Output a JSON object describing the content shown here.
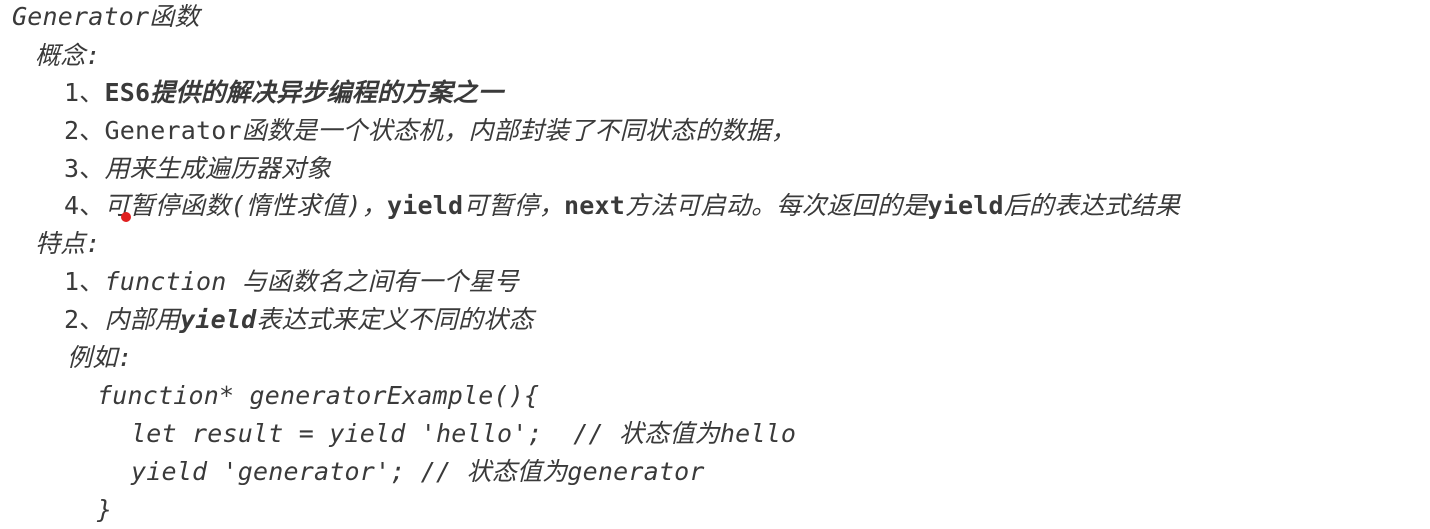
{
  "title": "Generator函数",
  "concepts": {
    "heading": "概念:",
    "items": [
      {
        "num": "1、",
        "parts": [
          "ES6",
          "提供的解决异步编程的方案之一"
        ]
      },
      {
        "num": "2、",
        "parts": [
          "Generator",
          "函数是一个状态机，内部封装了不同状态的数据，"
        ]
      },
      {
        "num": "3、",
        "parts": [
          "用来生成遍历器对象"
        ]
      },
      {
        "num": "4、",
        "parts": [
          "可暂停函数(惰性求值)，",
          "yield",
          "可暂停，",
          "next",
          "方法可启动。每次返回的是",
          "yield",
          "后的表达式结果"
        ]
      }
    ]
  },
  "features": {
    "heading": "特点:",
    "items": [
      {
        "num": "1、",
        "parts": [
          "function ",
          "与函数名之间有一个星号"
        ]
      },
      {
        "num": "2、",
        "parts": [
          "内部用",
          "yield",
          "表达式来定义不同的状态"
        ]
      }
    ],
    "example_label": "例如:",
    "code": [
      "function* generatorExample(){",
      "let result = yield 'hello';  // 状态值为hello",
      "yield 'generator'; // 状态值为generator",
      "}"
    ]
  },
  "annotation_color": "#e02020"
}
